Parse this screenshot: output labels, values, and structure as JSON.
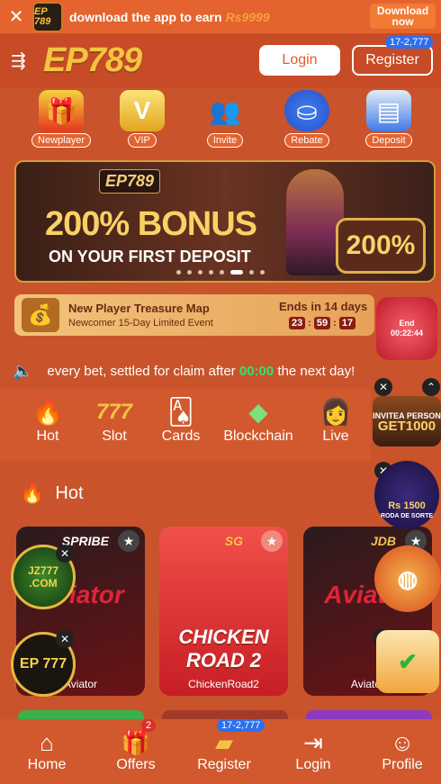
{
  "topbar": {
    "close": "✕",
    "app_logo": "EP 789",
    "text": "download the app to earn",
    "amount": "Rs9999",
    "button": "Download now"
  },
  "header": {
    "logo": "EP789",
    "login": "Login",
    "register": "Register",
    "register_badge": "17-2,777"
  },
  "categories": [
    {
      "label": "Newplayer",
      "icon": "gift-icon"
    },
    {
      "label": "VIP",
      "icon": "vip-icon"
    },
    {
      "label": "Invite",
      "icon": "people-icon"
    },
    {
      "label": "Rebate",
      "icon": "chips-icon"
    },
    {
      "label": "Deposit",
      "icon": "wallet-icon"
    }
  ],
  "banner": {
    "logo": "EP789",
    "headline": "200% BONUS",
    "subline": "ON YOUR FIRST DEPOSIT",
    "badge": "200%"
  },
  "treasure": {
    "title": "New Player Treasure Map",
    "subtitle": "Newcomer 15-Day Limited Event",
    "ends": "Ends in 14 days",
    "h": "23",
    "m": "59",
    "s": "17"
  },
  "ticker": {
    "pre": "every bet, settled for claim after",
    "time": "00:00",
    "post": "the next day!"
  },
  "game_tabs": [
    {
      "label": "Hot",
      "icon": "fire-icon"
    },
    {
      "label": "Slot",
      "icon": "slot-777-icon"
    },
    {
      "label": "Cards",
      "icon": "cards-icon"
    },
    {
      "label": "Blockchain",
      "icon": "blocks-icon"
    },
    {
      "label": "Live",
      "icon": "live-dealer-icon"
    }
  ],
  "section": {
    "title": "Hot"
  },
  "games": [
    {
      "name": "Aviator",
      "brand": "SPRIBE",
      "art": "Aviator"
    },
    {
      "name": "ChickenRoad2",
      "brand": "SG",
      "art": "CHICKEN ROAD 2"
    },
    {
      "name": "Aviator",
      "brand": "JDB",
      "art": "Aviator"
    }
  ],
  "floats": {
    "envelope_timer_label": "End",
    "envelope_timer": "00:22:44",
    "invite_text": "INVITEA PERSON",
    "invite_amount": "GET1000",
    "wheel_amount": "Rs 1500",
    "wheel_label": "RODA DE SORTE",
    "jz_label": "JZ777 .COM",
    "ep_label": "EP 777"
  },
  "bottom_nav": [
    {
      "label": "Home",
      "icon": "home-icon"
    },
    {
      "label": "Offers",
      "icon": "gift-icon",
      "badge": "2"
    },
    {
      "label": "Register",
      "icon": "register-icon",
      "badge": "17-2,777"
    },
    {
      "label": "Login",
      "icon": "login-icon"
    },
    {
      "label": "Profile",
      "icon": "profile-icon"
    }
  ]
}
